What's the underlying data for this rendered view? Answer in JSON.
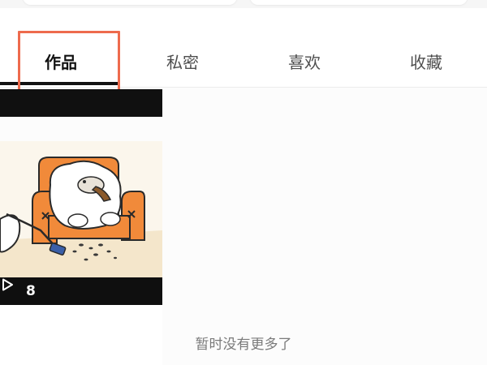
{
  "tabs": [
    {
      "label": "作品",
      "active": true
    },
    {
      "label": "私密",
      "active": false
    },
    {
      "label": "喜欢",
      "active": false
    },
    {
      "label": "收藏",
      "active": false
    }
  ],
  "video": {
    "play_count": "8",
    "icon": "play-icon"
  },
  "empty_message": "暂时没有更多了",
  "colors": {
    "highlight": "#ee6b4d",
    "active_tab": "#111111",
    "inactive_tab": "#4e4e4e",
    "sofa": "#f18a3a"
  }
}
